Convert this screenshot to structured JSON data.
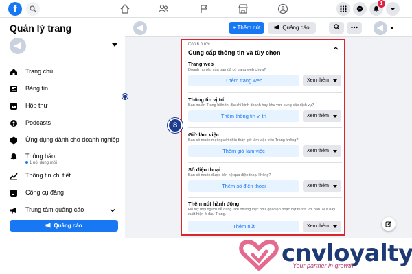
{
  "topbar": {
    "notifications_count": "1"
  },
  "sidebar": {
    "title": "Quản lý trang",
    "items": [
      {
        "label": "Trang chủ",
        "icon": "home-icon"
      },
      {
        "label": "Bảng tin",
        "icon": "news-feed-icon"
      },
      {
        "label": "Hộp thư",
        "icon": "inbox-icon"
      },
      {
        "label": "Podcasts",
        "icon": "podcast-icon"
      },
      {
        "label": "Ứng dụng dành cho doanh nghiệp",
        "icon": "business-apps-icon"
      },
      {
        "label": "Thông báo",
        "sub": "1 nội dung mới",
        "icon": "bell-icon"
      },
      {
        "label": "Thông tin chi tiết",
        "icon": "insights-icon"
      },
      {
        "label": "Công cụ đăng",
        "icon": "publishing-tools-icon"
      },
      {
        "label": "Trung tâm quảng cáo",
        "icon": "ad-center-icon"
      }
    ],
    "ad_button": "Quảng cáo"
  },
  "header": {
    "add_button": "+ Thêm nút",
    "promote_button": "Quảng cáo"
  },
  "setup": {
    "steps_label": "Còn 6 bước",
    "title": "Cung cấp thông tin và tùy chọn",
    "more_label": "Xem thêm",
    "sections": [
      {
        "title": "Trang web",
        "desc": "Doanh nghiệp của bạn đã có trang web chưa?",
        "action": "Thêm trang web"
      },
      {
        "title": "Thông tin vị trí",
        "desc": "Bạn muốn Trang hiển thị địa chỉ kinh doanh hay khu vực cung cấp dịch vụ?",
        "action": "Thêm thông tin vị trí"
      },
      {
        "title": "Giờ làm việc",
        "desc": "Bạn có muốn mọi người nhìn thấy giờ làm việc trên Trang không?",
        "action": "Thêm giờ làm việc"
      },
      {
        "title": "Số điện thoại",
        "desc": "Bạn có muốn được liên hệ qua điện thoại không?",
        "action": "Thêm số điện thoại"
      },
      {
        "title": "Thêm nút hành động",
        "desc": "Hỗ trợ mọi người dễ dàng làm những việc như gọi điện hoặc đặt trước với bạn. Nút này xuất hiện ở đầu Trang.",
        "action": "Thêm nút"
      }
    ]
  },
  "step_marker": "8",
  "watermark": {
    "brand": "cnvloyalty",
    "tagline": "Your partner in growth"
  },
  "colors": {
    "brand_blue": "#1877f2",
    "highlight_red": "#d9262c",
    "marker_navy": "#1d3c8f",
    "watermark_navy": "#1e3a75",
    "watermark_pink": "#b03a6e"
  }
}
